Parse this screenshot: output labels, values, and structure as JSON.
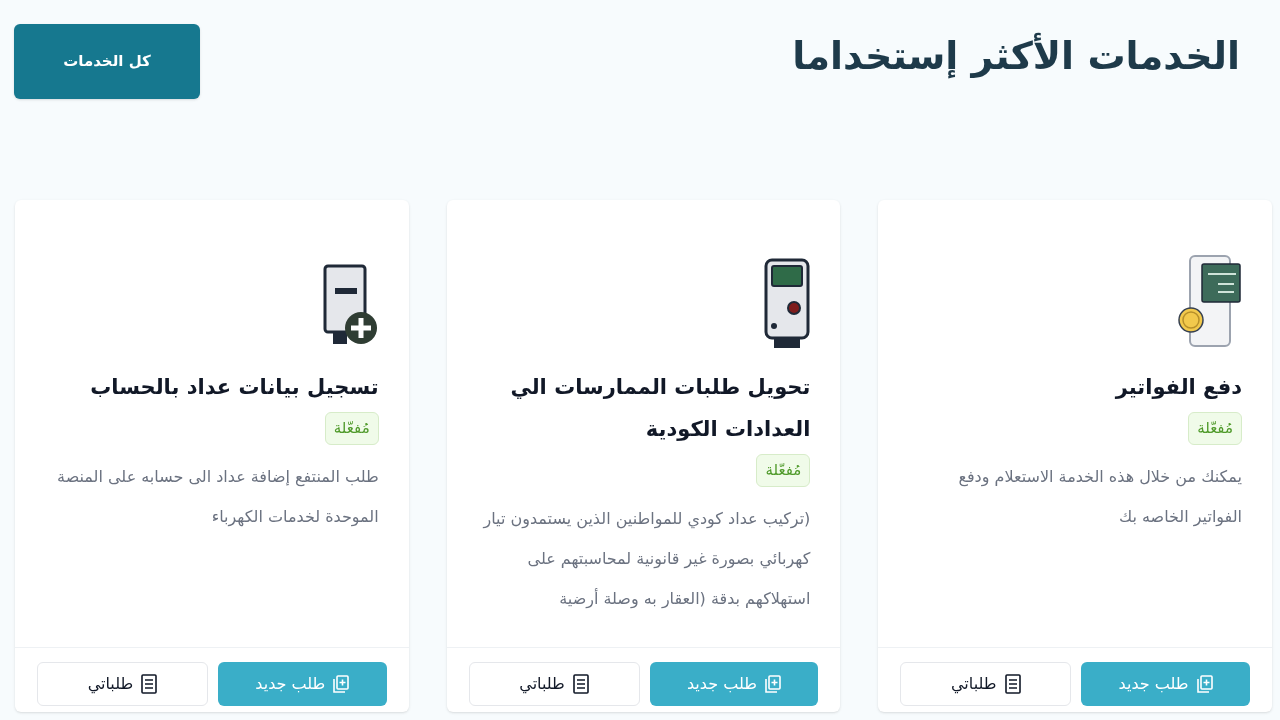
{
  "header": {
    "title": "الخدمات الأكثر إستخداما",
    "all_services_button": "كل الخدمات"
  },
  "cards": [
    {
      "kind": "bills",
      "title": "دفع الفواتير",
      "status": "مُفعّلة",
      "description": "يمكنك من خلال هذه الخدمة الاستعلام ودفع الفواتير الخاصه بك",
      "new_request": "طلب جديد",
      "my_requests": "طلباتي"
    },
    {
      "kind": "coded-meter",
      "title": "تحويل طلبات الممارسات الي العدادات الكودية",
      "status": "مُفعّلة",
      "description": "(تركيب عداد كودي للمواطنين الذين يستمدون تيار كهربائي بصورة غير قانونية لمحاسبتهم على استهلاكهم بدقة (العقار به وصلة أرضية",
      "new_request": "طلب جديد",
      "my_requests": "طلباتي"
    },
    {
      "kind": "meter-add",
      "title": "تسجيل بيانات عداد بالحساب",
      "status": "مُفعّلة",
      "description": "طلب المنتفع إضافة عداد الى حسابه على المنصة الموحدة لخدمات الكهرباء",
      "new_request": "طلب جديد",
      "my_requests": "طلباتي"
    }
  ]
}
